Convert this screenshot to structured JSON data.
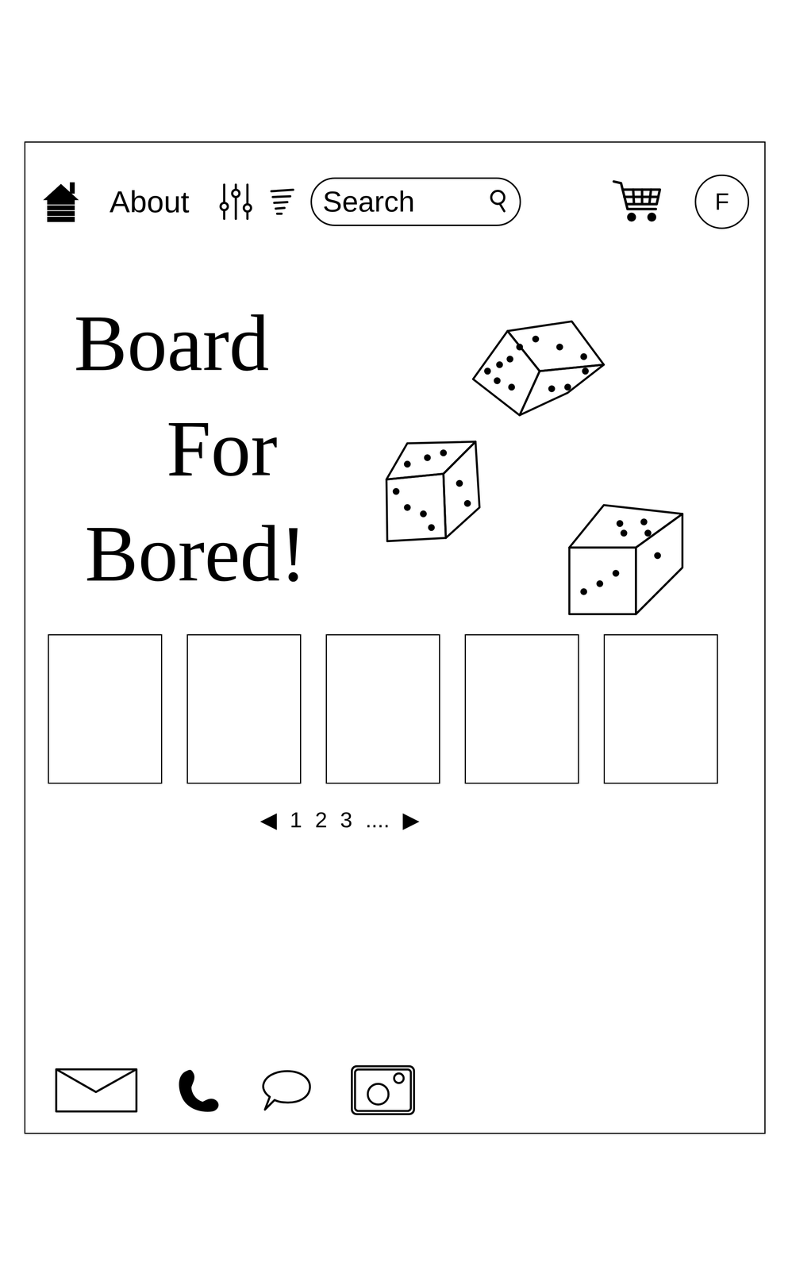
{
  "nav": {
    "about": "About",
    "search": {
      "placeholder": "Search"
    },
    "profile": "F"
  },
  "hero": {
    "lines": [
      "Board",
      "For",
      "Bored!"
    ]
  },
  "cards": [
    {},
    {},
    {},
    {},
    {}
  ],
  "pagination": {
    "prev": "◀",
    "pages": [
      "1",
      "2",
      "3"
    ],
    "ellipsis": "....",
    "next": "▶"
  }
}
